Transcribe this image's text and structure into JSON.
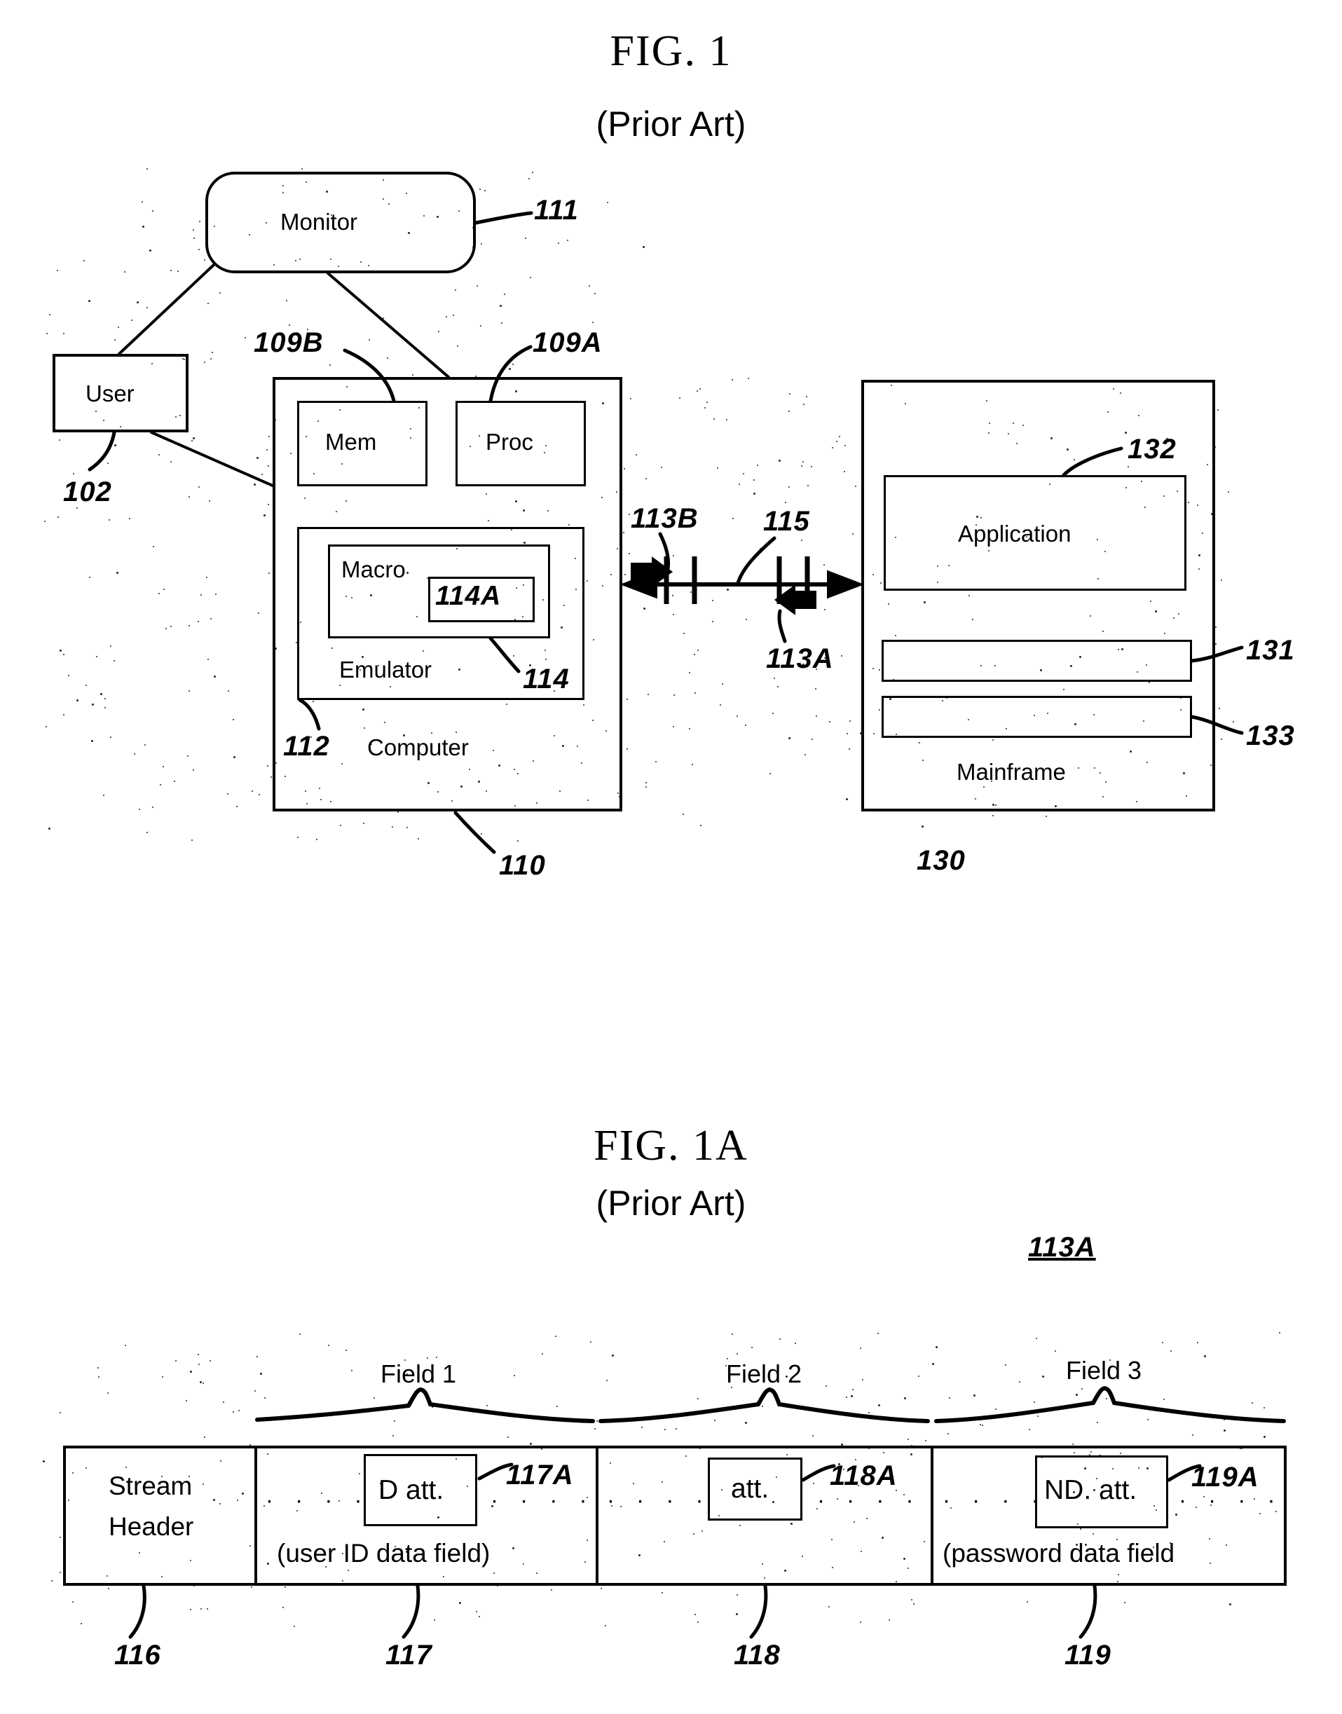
{
  "figures": [
    {
      "id": "fig1",
      "title": "FIG. 1",
      "subtitle": "(Prior Art)",
      "nodes": {
        "monitor": "Monitor",
        "user": "User",
        "mem": "Mem",
        "proc": "Proc",
        "macro": "Macro",
        "emulator": "Emulator",
        "computer": "Computer",
        "application": "Application",
        "mainframe": "Mainframe"
      },
      "refs": {
        "monitor": "111",
        "user": "102",
        "mem": "109B",
        "proc": "109A",
        "macro_inner": "114A",
        "emulator": "114",
        "emulator_box": "112",
        "computer": "110",
        "link_b": "113B",
        "link_mid": "115",
        "link_a": "113A",
        "application": "132",
        "bar_top": "131",
        "bar_bottom": "133",
        "mainframe": "130"
      }
    },
    {
      "id": "fig1a",
      "title": "FIG. 1A",
      "subtitle": "(Prior Art)",
      "corner_ref": "113A",
      "field_braces": [
        "Field 1",
        "Field 2",
        "Field 3"
      ],
      "cells": [
        {
          "name": "stream-header",
          "label_line1": "Stream",
          "label_line2": "Header",
          "attr": null,
          "attr_ref": null,
          "caption": null,
          "ref": "116"
        },
        {
          "name": "field-1",
          "label_line1": null,
          "label_line2": null,
          "attr": "D att.",
          "attr_ref": "117A",
          "caption": "(user ID data field)",
          "ref": "117"
        },
        {
          "name": "field-2",
          "label_line1": null,
          "label_line2": null,
          "attr": "att.",
          "attr_ref": "118A",
          "caption": null,
          "ref": "118"
        },
        {
          "name": "field-3",
          "label_line1": null,
          "label_line2": null,
          "attr": "ND. att.",
          "attr_ref": "119A",
          "caption": "(password data field",
          "ref": "119"
        }
      ],
      "dot_run": "· · · ·"
    }
  ],
  "colors": {
    "ink": "#000000",
    "paper": "#ffffff"
  }
}
